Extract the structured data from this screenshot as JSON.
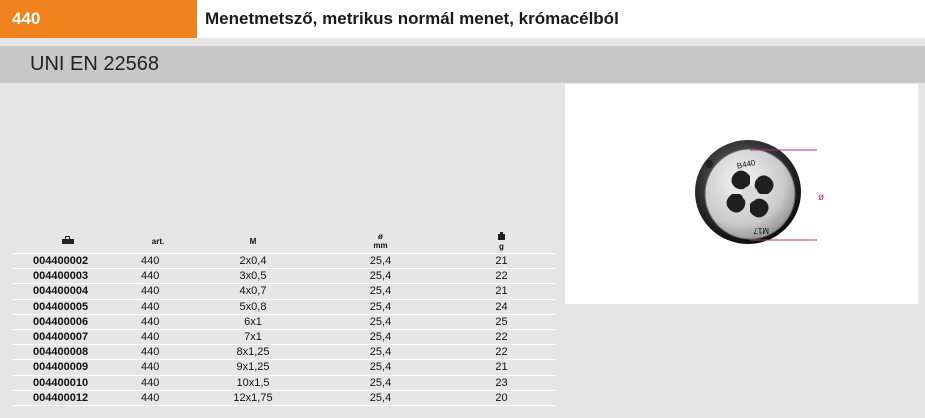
{
  "header": {
    "code": "440",
    "title": "Menetmetsző, metrikus normál menet, krómacélból"
  },
  "standard": "UNI EN 22568",
  "image": {
    "die_marking_top": "B440",
    "die_marking_bottom": "M17",
    "dimension_label": "ø"
  },
  "table": {
    "headers": {
      "code_icon": "package-icon",
      "art": "art.",
      "m": "M",
      "diameter": "ø",
      "diameter_unit": "mm",
      "weight_icon": "weight-icon",
      "weight_unit": "g"
    },
    "rows": [
      {
        "code": "004400002",
        "art": "440",
        "m": "2x0,4",
        "d": "25,4",
        "g": "21"
      },
      {
        "code": "004400003",
        "art": "440",
        "m": "3x0,5",
        "d": "25,4",
        "g": "22"
      },
      {
        "code": "004400004",
        "art": "440",
        "m": "4x0,7",
        "d": "25,4",
        "g": "21"
      },
      {
        "code": "004400005",
        "art": "440",
        "m": "5x0,8",
        "d": "25,4",
        "g": "24"
      },
      {
        "code": "004400006",
        "art": "440",
        "m": "6x1",
        "d": "25,4",
        "g": "25"
      },
      {
        "code": "004400007",
        "art": "440",
        "m": "7x1",
        "d": "25,4",
        "g": "22"
      },
      {
        "code": "004400008",
        "art": "440",
        "m": "8x1,25",
        "d": "25,4",
        "g": "22"
      },
      {
        "code": "004400009",
        "art": "440",
        "m": "9x1,25",
        "d": "25,4",
        "g": "21"
      },
      {
        "code": "004400010",
        "art": "440",
        "m": "10x1,5",
        "d": "25,4",
        "g": "23"
      },
      {
        "code": "004400012",
        "art": "440",
        "m": "12x1,75",
        "d": "25,4",
        "g": "20"
      }
    ]
  }
}
